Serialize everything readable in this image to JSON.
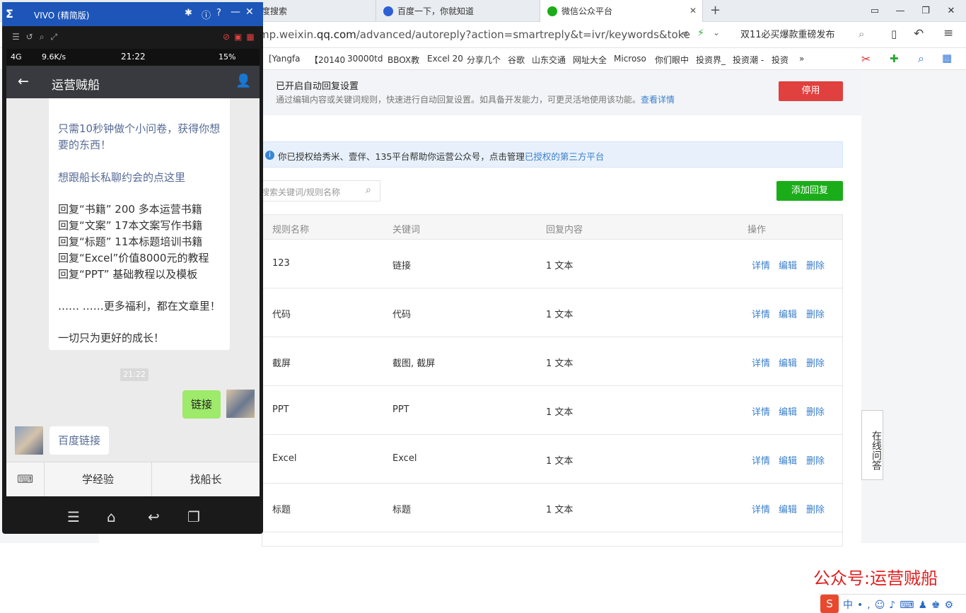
{
  "browser": {
    "tabs": [
      {
        "label": "度搜索"
      },
      {
        "label": "百度一下，你就知道"
      },
      {
        "label": "微信公众平台",
        "active": true
      }
    ],
    "new_tab": "+",
    "url_prefix": "mp.weixin.",
    "url_domain": "qq.com",
    "url_path": "/advanced/autoreply?action=smartreply&t=ivr/keywords&toke",
    "search_box": "双11必买爆款重磅发布",
    "bookmarks": [
      "[Yangfa",
      "【20140",
      "30000td",
      "BBOX教",
      "Excel 20",
      "分享几个",
      "谷歌",
      "山东交通",
      "网址大全",
      "Microso",
      "你们眼中",
      "投资界_",
      "投资潮 -",
      "投资"
    ],
    "bookmarks_more": "»"
  },
  "notice": {
    "title": "已开启自动回复设置",
    "desc": "通过编辑内容或关键词规则，快速进行自动回复设置。如具备开发能力，可更灵活地使用该功能。",
    "link": "查看详情",
    "disable_button": "停用"
  },
  "auth": {
    "text": "你已授权给秀米、壹伴、135平台帮助你运营公众号，点击管理",
    "link": "已授权的第三方平台"
  },
  "search": {
    "placeholder": "搜索关键词/规则名称"
  },
  "add_button": "添加回复",
  "table": {
    "headers": [
      "规则名称",
      "关键词",
      "回复内容",
      "操作"
    ],
    "ops": [
      "详情",
      "编辑",
      "删除"
    ],
    "rows": [
      {
        "name": "123",
        "keyword": "链接",
        "reply": "1 文本"
      },
      {
        "name": "代码",
        "keyword": "代码",
        "reply": "1 文本"
      },
      {
        "name": "截屏",
        "keyword": "截图, 截屏",
        "reply": "1 文本"
      },
      {
        "name": "PPT",
        "keyword": "PPT",
        "reply": "1 文本"
      },
      {
        "name": "Excel",
        "keyword": "Excel",
        "reply": "1 文本"
      },
      {
        "name": "标题",
        "keyword": "标题",
        "reply": "1 文本"
      }
    ]
  },
  "float_qa": "在线问答",
  "watermark": "公众号:运营贼船",
  "phone": {
    "window_title": "VIVO (精简版)",
    "status": {
      "network": "4G",
      "speed": "9.6K/s",
      "time": "21:22",
      "battery": "15%"
    },
    "chat_title": "运营贼船",
    "bubble_lines": [
      {
        "text": "只需10秒钟做个小问卷，获得你想",
        "link": true
      },
      {
        "text": "要的东西！",
        "link": true
      },
      {
        "text": "想跟船长私聊约会的点这里",
        "link": true
      },
      {
        "text": "回复“书籍”  200 多本运营书籍",
        "link": false
      },
      {
        "text": "回复“文案”  17本文案写作书籍",
        "link": false
      },
      {
        "text": "回复“标题”  11本标题培训书籍",
        "link": false
      },
      {
        "text": "回复“Excel”价值8000元的教程",
        "link": false
      },
      {
        "text": "回复“PPT”  基础教程以及模板",
        "link": false
      },
      {
        "text": "…… ……更多福利，都在文章里！",
        "link": false
      },
      {
        "text": "一切只为更好的成长！",
        "link": false
      }
    ],
    "time_stamp": "21:22",
    "msg_out": "链接",
    "msg_in": "百度链接",
    "menu": [
      "学经验",
      "找船长"
    ]
  }
}
